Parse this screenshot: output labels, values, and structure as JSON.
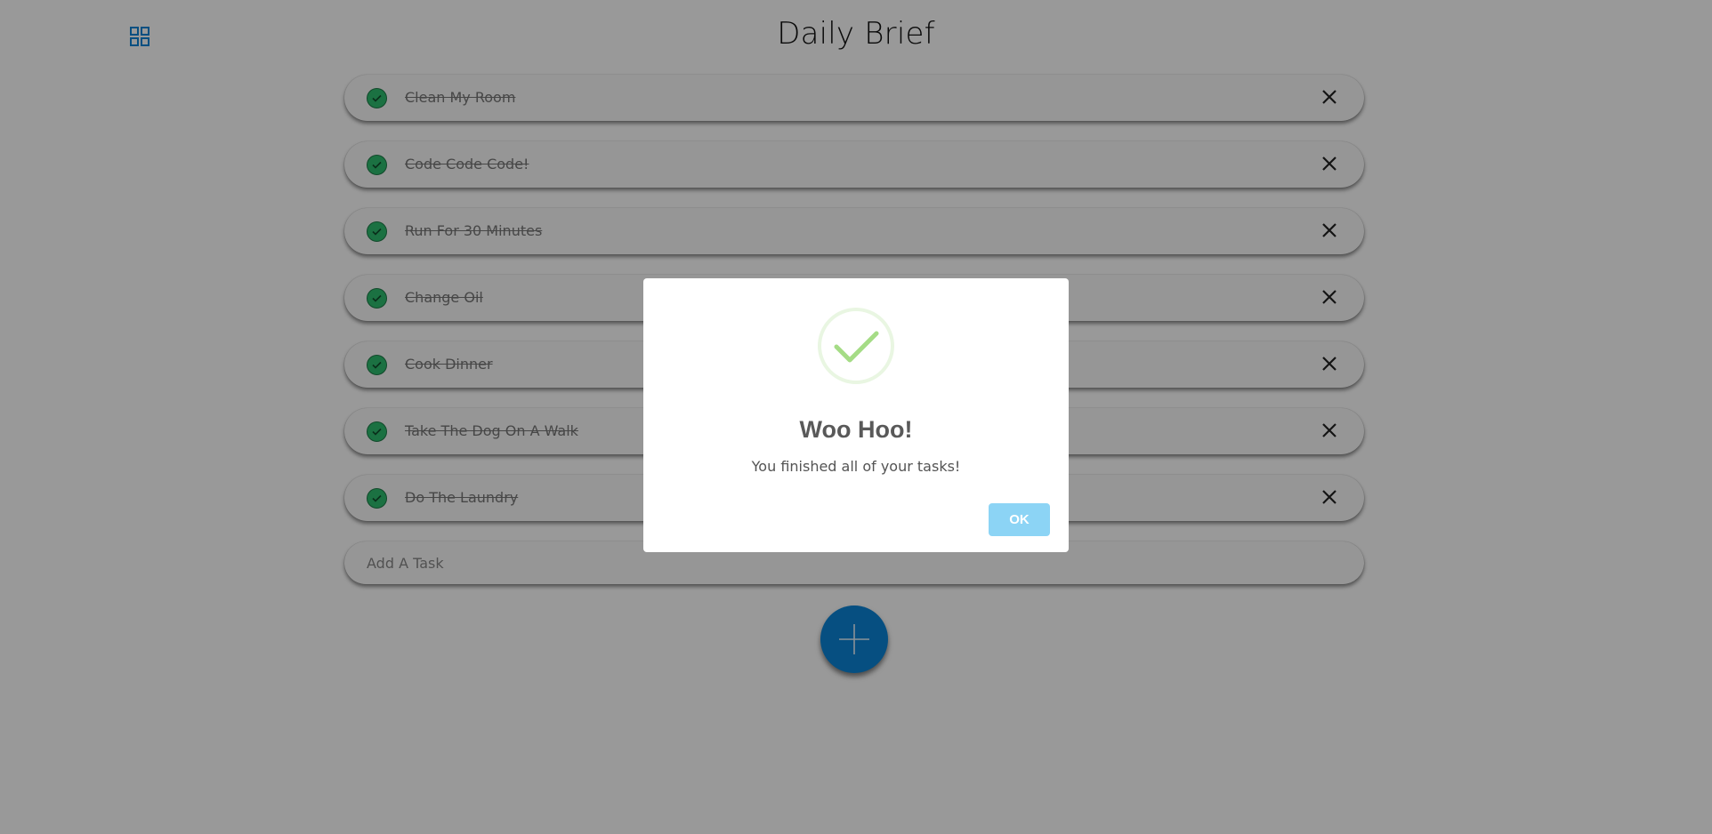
{
  "header": {
    "title": "Daily Brief",
    "menu_icon": "grid-icon"
  },
  "tasks": [
    {
      "label": "Clean My Room",
      "completed": true
    },
    {
      "label": "Code Code Code!",
      "completed": true
    },
    {
      "label": "Run For 30 Minutes",
      "completed": true
    },
    {
      "label": "Change Oil",
      "completed": true
    },
    {
      "label": "Cook Dinner",
      "completed": true
    },
    {
      "label": "Take The Dog On A Walk",
      "completed": true
    },
    {
      "label": "Do The Laundry",
      "completed": true
    }
  ],
  "add_task": {
    "placeholder": "Add A Task",
    "value": ""
  },
  "fab": {
    "icon": "plus-icon"
  },
  "modal": {
    "icon": "checkmark-icon",
    "title": "Woo Hoo!",
    "text": "You finished all of your tasks!",
    "ok_label": "OK"
  },
  "colors": {
    "accent": "#0a84d8",
    "check": "#2dbd6e",
    "ok_button": "#8cd4f5",
    "success_check": "#a5dc86",
    "overlay": "rgba(0,0,0,0.4)"
  }
}
